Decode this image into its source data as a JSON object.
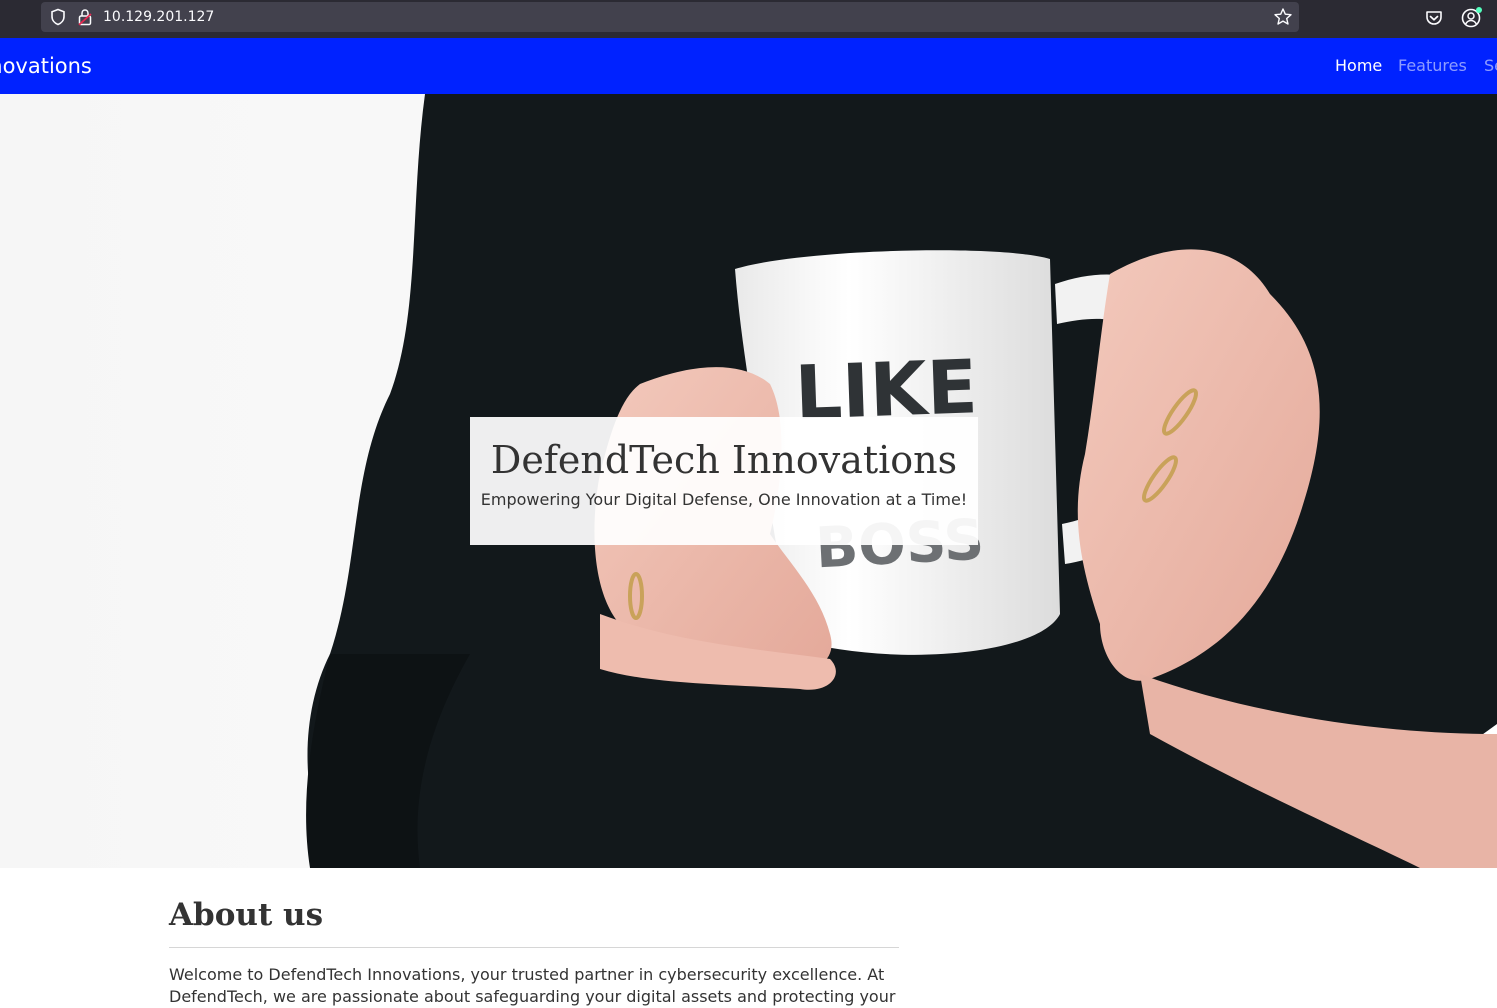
{
  "browser": {
    "url": "10.129.201.127",
    "icons": [
      "shield-icon",
      "lock-icon",
      "star-icon",
      "pocket-icon",
      "account-icon"
    ]
  },
  "navbar": {
    "brand": "DefendTech Innovations",
    "links": [
      {
        "label": "Home",
        "active": true
      },
      {
        "label": "Features",
        "active": false
      },
      {
        "label": "Services",
        "active": false
      }
    ],
    "background_color": "#0022ff"
  },
  "hero": {
    "title": "DefendTech Innovations",
    "subtitle": "Empowering Your Digital Defense, One Innovation at a Time!",
    "mug_text": "LIKE A BOSS"
  },
  "about": {
    "heading": "About us",
    "text": "Welcome to DefendTech Innovations, your trusted partner in cybersecurity excellence. At DefendTech, we are passionate about safeguarding your digital assets and protecting your"
  }
}
